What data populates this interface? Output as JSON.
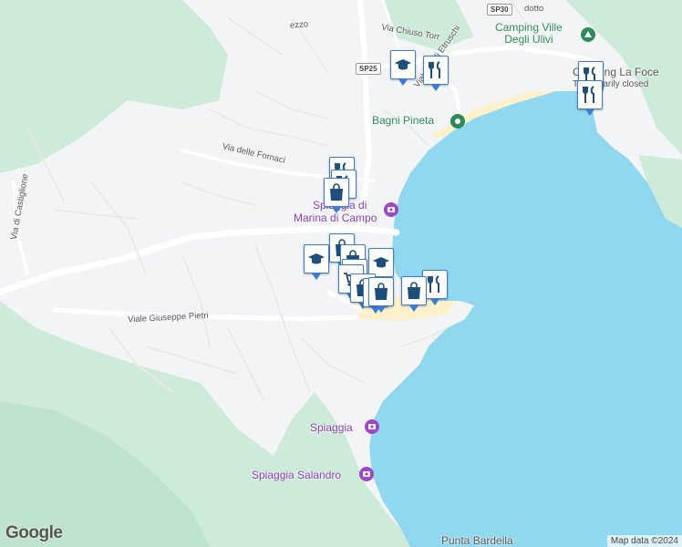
{
  "map": {
    "colors": {
      "water": "#8fd8ef",
      "land": "#f3f4f6",
      "park": "#cdebd8",
      "beach": "#fbf1cc",
      "road": "#ffffff",
      "pin_border": "#3d7bd6",
      "pin_icon": "#1d4f7a"
    },
    "places": {
      "camping": "Camping Ville\nDegli Ulivi",
      "camping_la_foce": "Camping La Foce",
      "temporarily_closed": "Temporarily closed",
      "bagni_pineta": "Bagni Pineta",
      "spiaggia_marina_a": "Spiaggia di",
      "spiaggia_marina_b": "Marina di Campo",
      "spiaggia": "Spiaggia",
      "spiaggia_salandro": "Spiaggia Salandro",
      "punta_bardella": "Punta Bardella",
      "cost_partial": "C"
    },
    "streets": {
      "via_delle_fornaci": "Via delle Fornaci",
      "via_chiuso_torr": "Via Chiuso Torr",
      "viale_etruschi": "Viale degli Etruschi",
      "via_di_castiglione": "Via di Castiglione",
      "viale_giuseppe_pietri": "Viale Giuseppe Pietri",
      "mezzo": "ezzo",
      "dotto": "dotto"
    },
    "shields": {
      "sp30": "SP30",
      "sp25": "SP25"
    },
    "markers": [
      {
        "type": "education"
      },
      {
        "type": "restaurant"
      },
      {
        "type": "restaurant"
      },
      {
        "type": "restaurant"
      },
      {
        "type": "restaurant"
      },
      {
        "type": "restaurant"
      },
      {
        "type": "shopping"
      },
      {
        "type": "shopping"
      },
      {
        "type": "shopping"
      },
      {
        "type": "education"
      },
      {
        "type": "shopping"
      },
      {
        "type": "education"
      },
      {
        "type": "cart"
      },
      {
        "type": "shopping"
      },
      {
        "type": "shopping"
      },
      {
        "type": "restaurant"
      },
      {
        "type": "shopping"
      },
      {
        "type": "shopping"
      }
    ],
    "logo": "Google",
    "attribution": "Map data ©2024"
  }
}
